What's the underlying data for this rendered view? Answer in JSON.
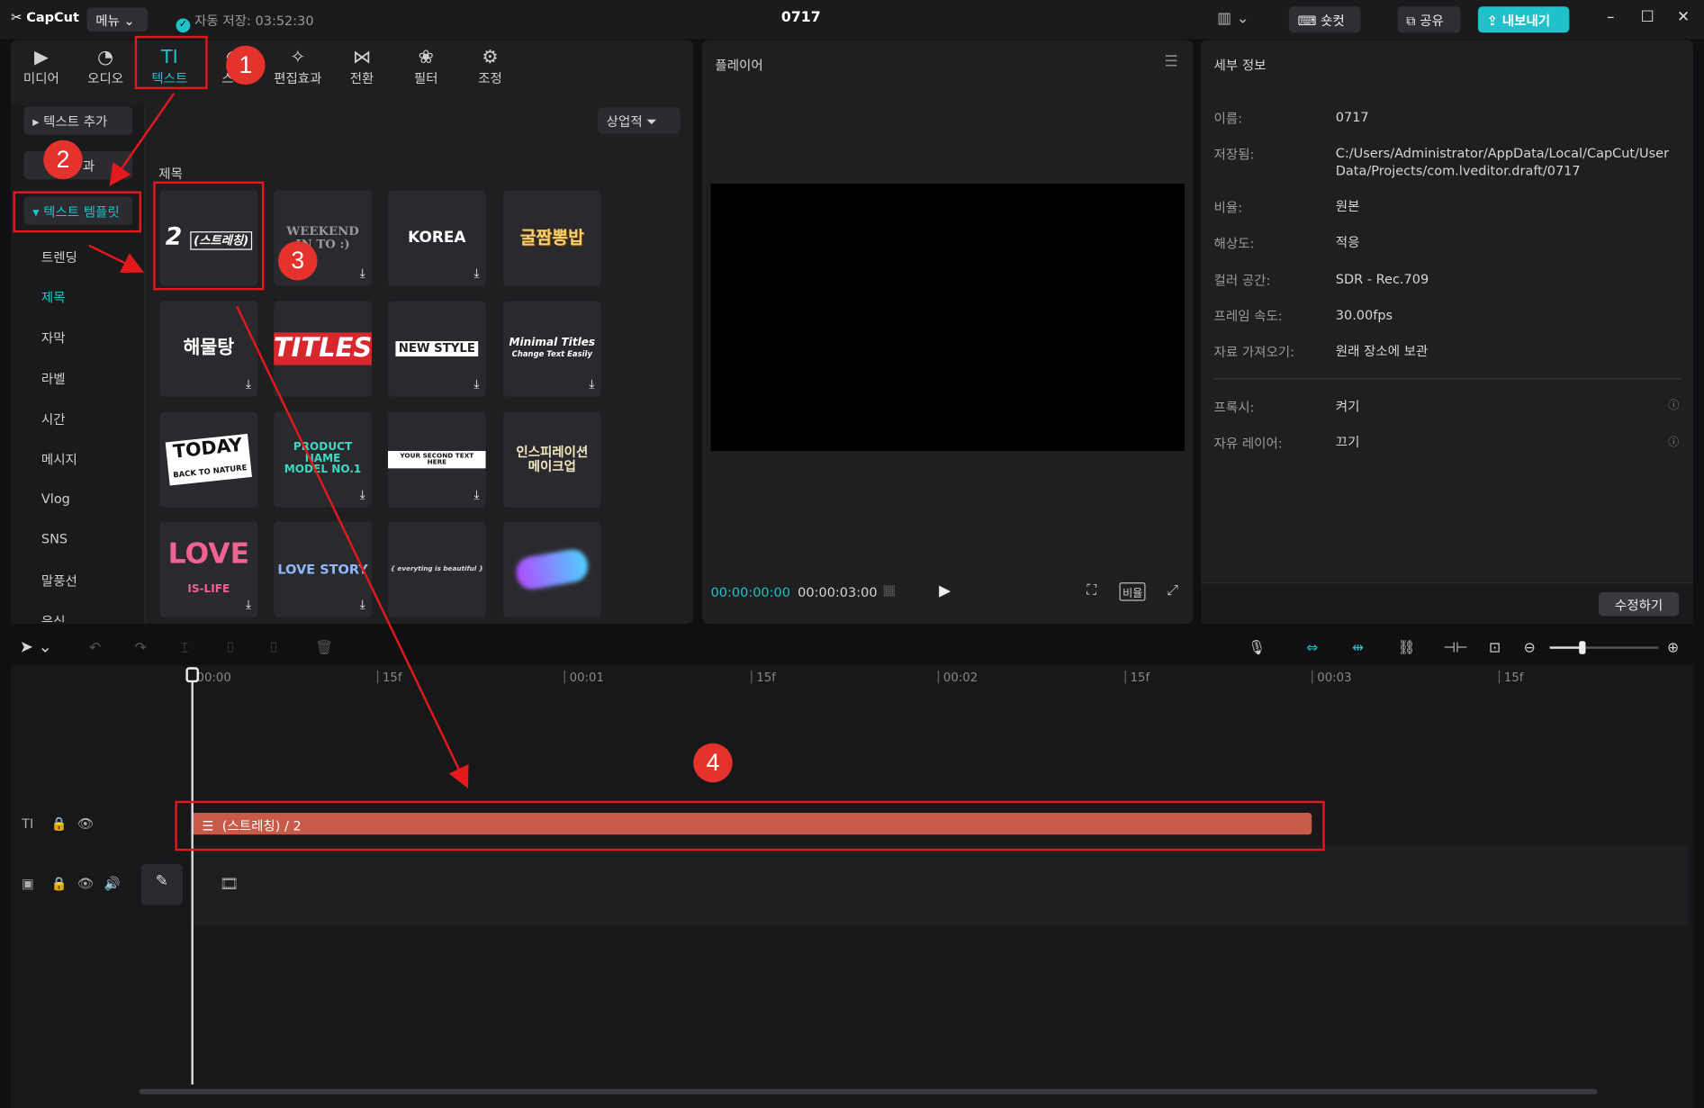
{
  "app": {
    "logo": "CapCut",
    "menu_label": "메뉴",
    "autosave": "자동 저장: 03:52:30",
    "project_title": "0717",
    "shortcut_label": "숏컷",
    "share_label": "공유",
    "export_label": "내보내기",
    "accent_color": "#1ec2c8"
  },
  "toolbar": {
    "tabs": [
      {
        "label": "미디어",
        "icon": "media-icon"
      },
      {
        "label": "오디오",
        "icon": "audio-icon"
      },
      {
        "label": "텍스트",
        "icon": "text-icon"
      },
      {
        "label": "스티",
        "icon": "sticker-icon"
      },
      {
        "label": "편집효과",
        "icon": "effects-icon"
      },
      {
        "label": "전환",
        "icon": "transition-icon"
      },
      {
        "label": "필터",
        "icon": "filter-icon"
      },
      {
        "label": "조정",
        "icon": "adjust-icon"
      }
    ]
  },
  "sidebar": {
    "add_text": "텍스트 추가",
    "effects_partial": "과",
    "templates": "텍스트 템플릿",
    "items": [
      "트렌딩",
      "제목",
      "자막",
      "라벨",
      "시간",
      "메시지",
      "Vlog",
      "SNS",
      "말풍선",
      "음식"
    ]
  },
  "library": {
    "filter_label": "상업적",
    "section": "제목",
    "templates": [
      {
        "line1": "2",
        "line2": "(스트레칭)"
      },
      {
        "line1": "WEEKEND",
        "line2": "IN TO :)"
      },
      {
        "line1": "KOREA",
        "line2": ""
      },
      {
        "line1": "굴짬뽕밥",
        "line2": ""
      },
      {
        "line1": "해물탕",
        "line2": ""
      },
      {
        "line1": "TITLES",
        "line2": ""
      },
      {
        "line1": "NEW STYLE",
        "line2": ""
      },
      {
        "line1": "Minimal Titles",
        "line2": "Change Text Easily"
      },
      {
        "line1": "TODAY",
        "line2": "BACK TO NATURE"
      },
      {
        "line1": "PRODUCT NAME",
        "line2": "MODEL NO.1"
      },
      {
        "line1": "YOUR SECOND TEXT HERE",
        "line2": ""
      },
      {
        "line1": "인스피레이션",
        "line2": "메이크업"
      },
      {
        "line1": "LOVE",
        "line2": "IS-LIFE"
      },
      {
        "line1": "LOVE STORY",
        "line2": ""
      },
      {
        "line1": "{ everyting is beautiful }",
        "line2": ""
      },
      {
        "line1": "",
        "line2": ""
      }
    ]
  },
  "player": {
    "title": "플레이어",
    "current_time": "00:00:00:00",
    "total_time": "00:00:03:00",
    "ratio_label": "비율"
  },
  "details": {
    "title": "세부 정보",
    "rows": [
      {
        "label": "이름:",
        "value": "0717"
      },
      {
        "label": "저장됨:",
        "value": "C:/Users/Administrator/AppData/Local/CapCut/User Data/Projects/com.lveditor.draft/0717"
      },
      {
        "label": "비율:",
        "value": "원본"
      },
      {
        "label": "해상도:",
        "value": "적응"
      },
      {
        "label": "컬러 공간:",
        "value": "SDR - Rec.709"
      },
      {
        "label": "프레임 속도:",
        "value": "30.00fps"
      },
      {
        "label": "자료 가져오기:",
        "value": "원래 장소에 보관"
      },
      {
        "label": "프록시:",
        "value": "켜기"
      },
      {
        "label": "자유 레이어:",
        "value": "끄기"
      }
    ],
    "edit_label": "수정하기"
  },
  "timeline": {
    "ruler": [
      "00:00",
      "15f",
      "00:01",
      "15f",
      "00:02",
      "15f",
      "00:03",
      "15f"
    ],
    "text_clip": "(스트레칭) / 2",
    "text_track_icon": "TI"
  },
  "annotations": {
    "steps": [
      "1",
      "2",
      "3",
      "4"
    ],
    "color": "#e4191b"
  }
}
